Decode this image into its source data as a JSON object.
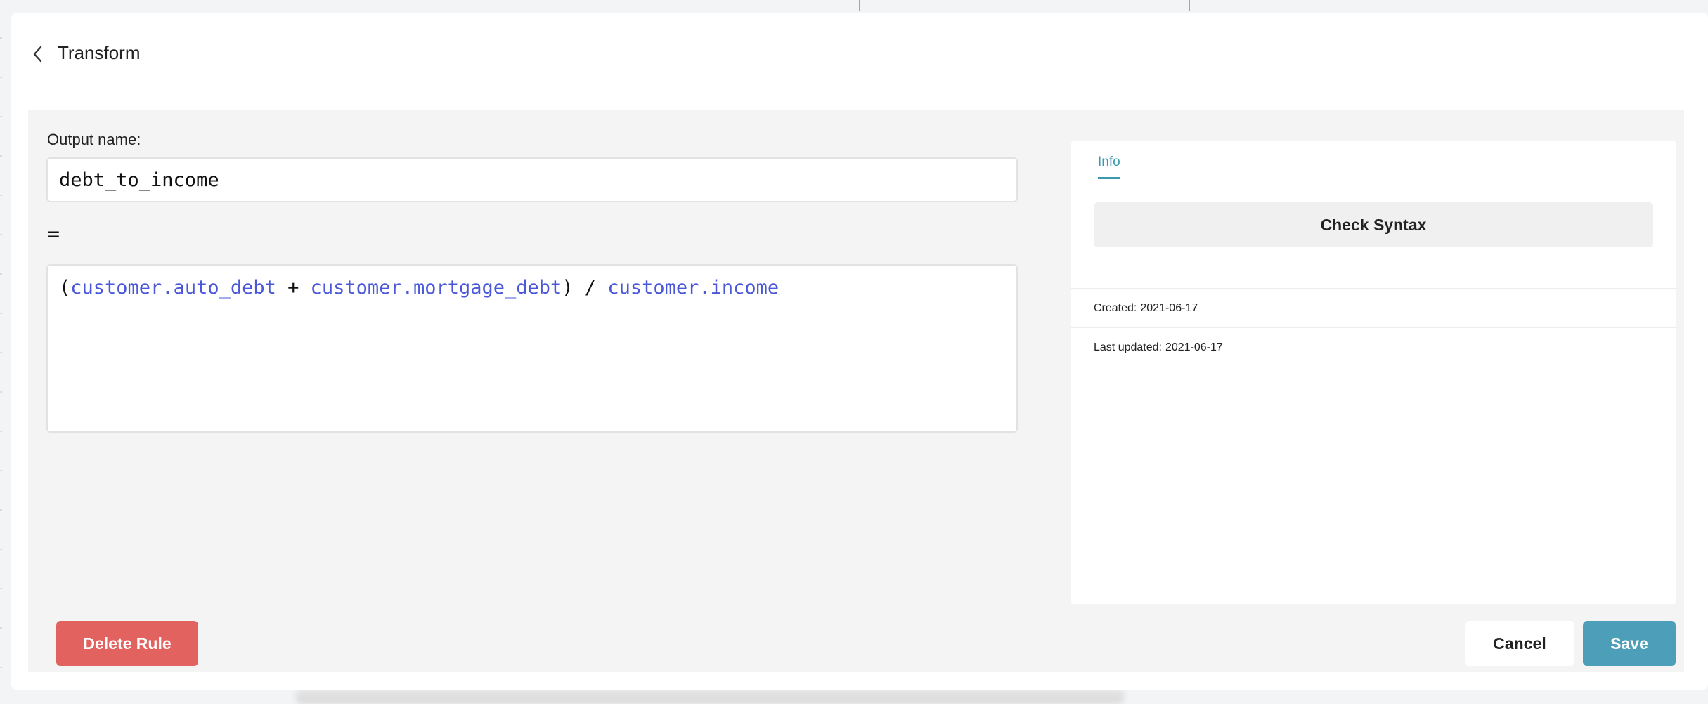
{
  "header": {
    "title": "Transform",
    "back_icon": "chevron-left-icon"
  },
  "form": {
    "output_name_label": "Output name:",
    "output_name_value": "debt_to_income",
    "equals_sign": "=",
    "expression_tokens": [
      {
        "text": "(",
        "kind": "op"
      },
      {
        "text": "customer.auto_debt",
        "kind": "field"
      },
      {
        "text": " + ",
        "kind": "op"
      },
      {
        "text": "customer.mortgage_debt",
        "kind": "field"
      },
      {
        "text": ") / ",
        "kind": "op"
      },
      {
        "text": "customer.income",
        "kind": "field"
      }
    ]
  },
  "info_panel": {
    "tab_label": "Info",
    "check_syntax_label": "Check Syntax",
    "created_label": "Created:",
    "created_value": "2021-06-17",
    "updated_label": "Last updated:",
    "updated_value": "2021-06-17"
  },
  "actions": {
    "delete_label": "Delete Rule",
    "cancel_label": "Cancel",
    "save_label": "Save"
  },
  "colors": {
    "field_token": "#4a57d8",
    "accent": "#3b99ad",
    "danger": "#e2625f",
    "primary": "#4d9fb9"
  }
}
